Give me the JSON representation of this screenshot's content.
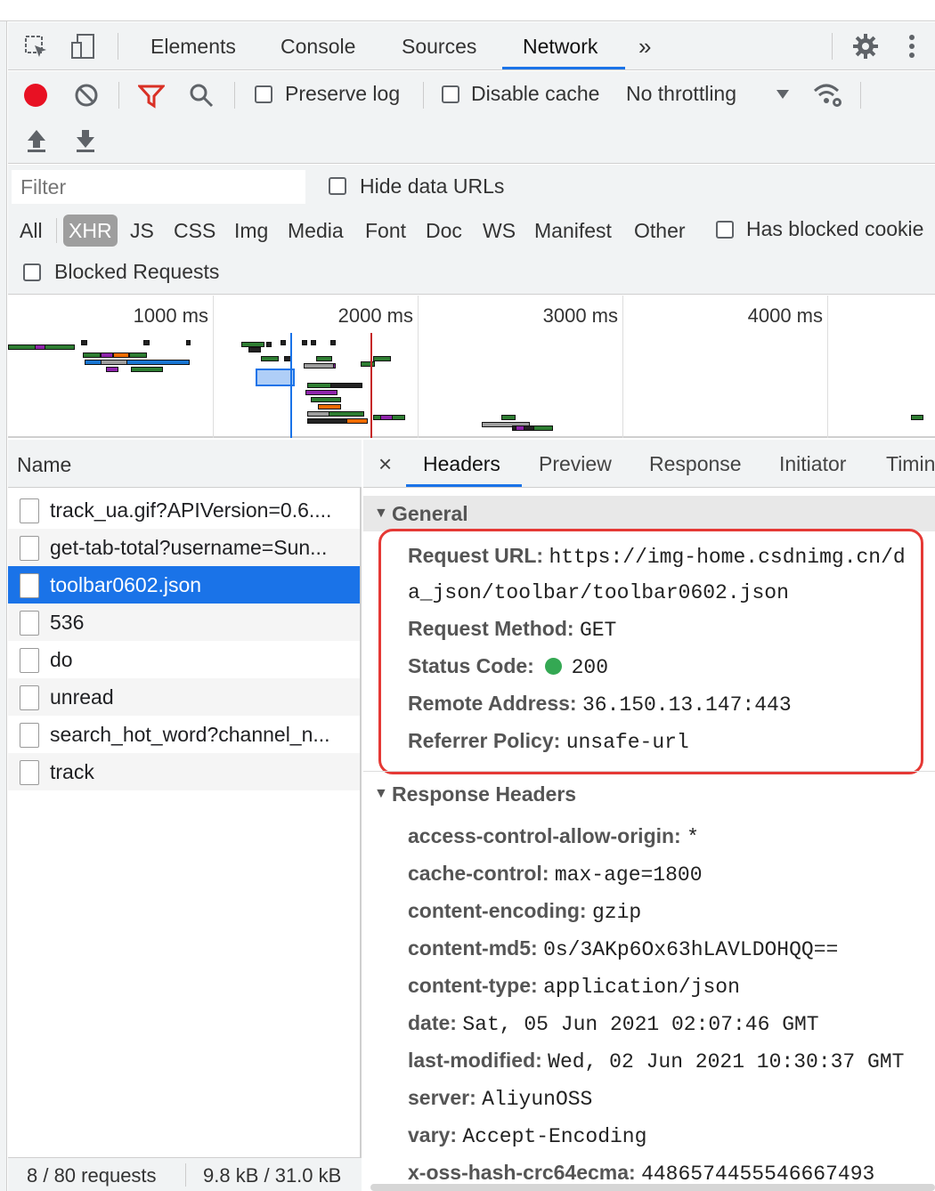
{
  "main_tabs": {
    "elements": "Elements",
    "console": "Console",
    "sources": "Sources",
    "network": "Network",
    "more": "»"
  },
  "toolbar": {
    "preserve_log": "Preserve log",
    "disable_cache": "Disable cache",
    "throttling": "No throttling"
  },
  "filter": {
    "placeholder": "Filter",
    "hide_data_urls": "Hide data URLs",
    "types": [
      "All",
      "XHR",
      "JS",
      "CSS",
      "Img",
      "Media",
      "Font",
      "Doc",
      "WS",
      "Manifest",
      "Other"
    ],
    "active_type": "XHR",
    "has_blocked_cookies": "Has blocked cookie",
    "blocked_requests": "Blocked Requests"
  },
  "overview": {
    "ticks": [
      "1000 ms",
      "2000 ms",
      "3000 ms",
      "4000 ms"
    ]
  },
  "requests": {
    "header": "Name",
    "items": [
      "track_ua.gif?APIVersion=0.6....",
      "get-tab-total?username=Sun...",
      "toolbar0602.json",
      "536",
      "do",
      "unread",
      "search_hot_word?channel_n...",
      "track"
    ],
    "selected": "toolbar0602.json",
    "footer_count": "8 / 80 requests",
    "footer_size": "9.8 kB / 31.0 kB"
  },
  "detail_tabs": {
    "close": "×",
    "headers": "Headers",
    "preview": "Preview",
    "response": "Response",
    "initiator": "Initiator",
    "timing": "Timin"
  },
  "general": {
    "title": "General",
    "request_url_label": "Request URL:",
    "request_url_line1": "https://img-home.csdnimg.cn/d",
    "request_url_line2": "a_json/toolbar/toolbar0602.json",
    "method_label": "Request Method:",
    "method": "GET",
    "status_label": "Status Code:",
    "status": "200",
    "status_color": "#34a853",
    "remote_label": "Remote Address:",
    "remote": "36.150.13.147:443",
    "referrer_label": "Referrer Policy:",
    "referrer": "unsafe-url",
    "highlight_color": "#e53935"
  },
  "response_headers": {
    "title": "Response Headers",
    "items": [
      {
        "k": "access-control-allow-origin:",
        "v": "*"
      },
      {
        "k": "cache-control:",
        "v": "max-age=1800"
      },
      {
        "k": "content-encoding:",
        "v": "gzip"
      },
      {
        "k": "content-md5:",
        "v": "0s/3AKp6Ox63hLAVLDOHQQ=="
      },
      {
        "k": "content-type:",
        "v": "application/json"
      },
      {
        "k": "date:",
        "v": "Sat, 05 Jun 2021 02:07:46 GMT"
      },
      {
        "k": "last-modified:",
        "v": "Wed, 02 Jun 2021 10:30:37 GMT"
      },
      {
        "k": "server:",
        "v": "AliyunOSS"
      },
      {
        "k": "vary:",
        "v": "Accept-Encoding"
      },
      {
        "k": "x-oss-hash-crc64ecma:",
        "v": "4486574455546667493"
      }
    ]
  },
  "colors": {
    "accent": "#1a73e8",
    "record": "#e81123",
    "filter_active": "#d93025"
  }
}
